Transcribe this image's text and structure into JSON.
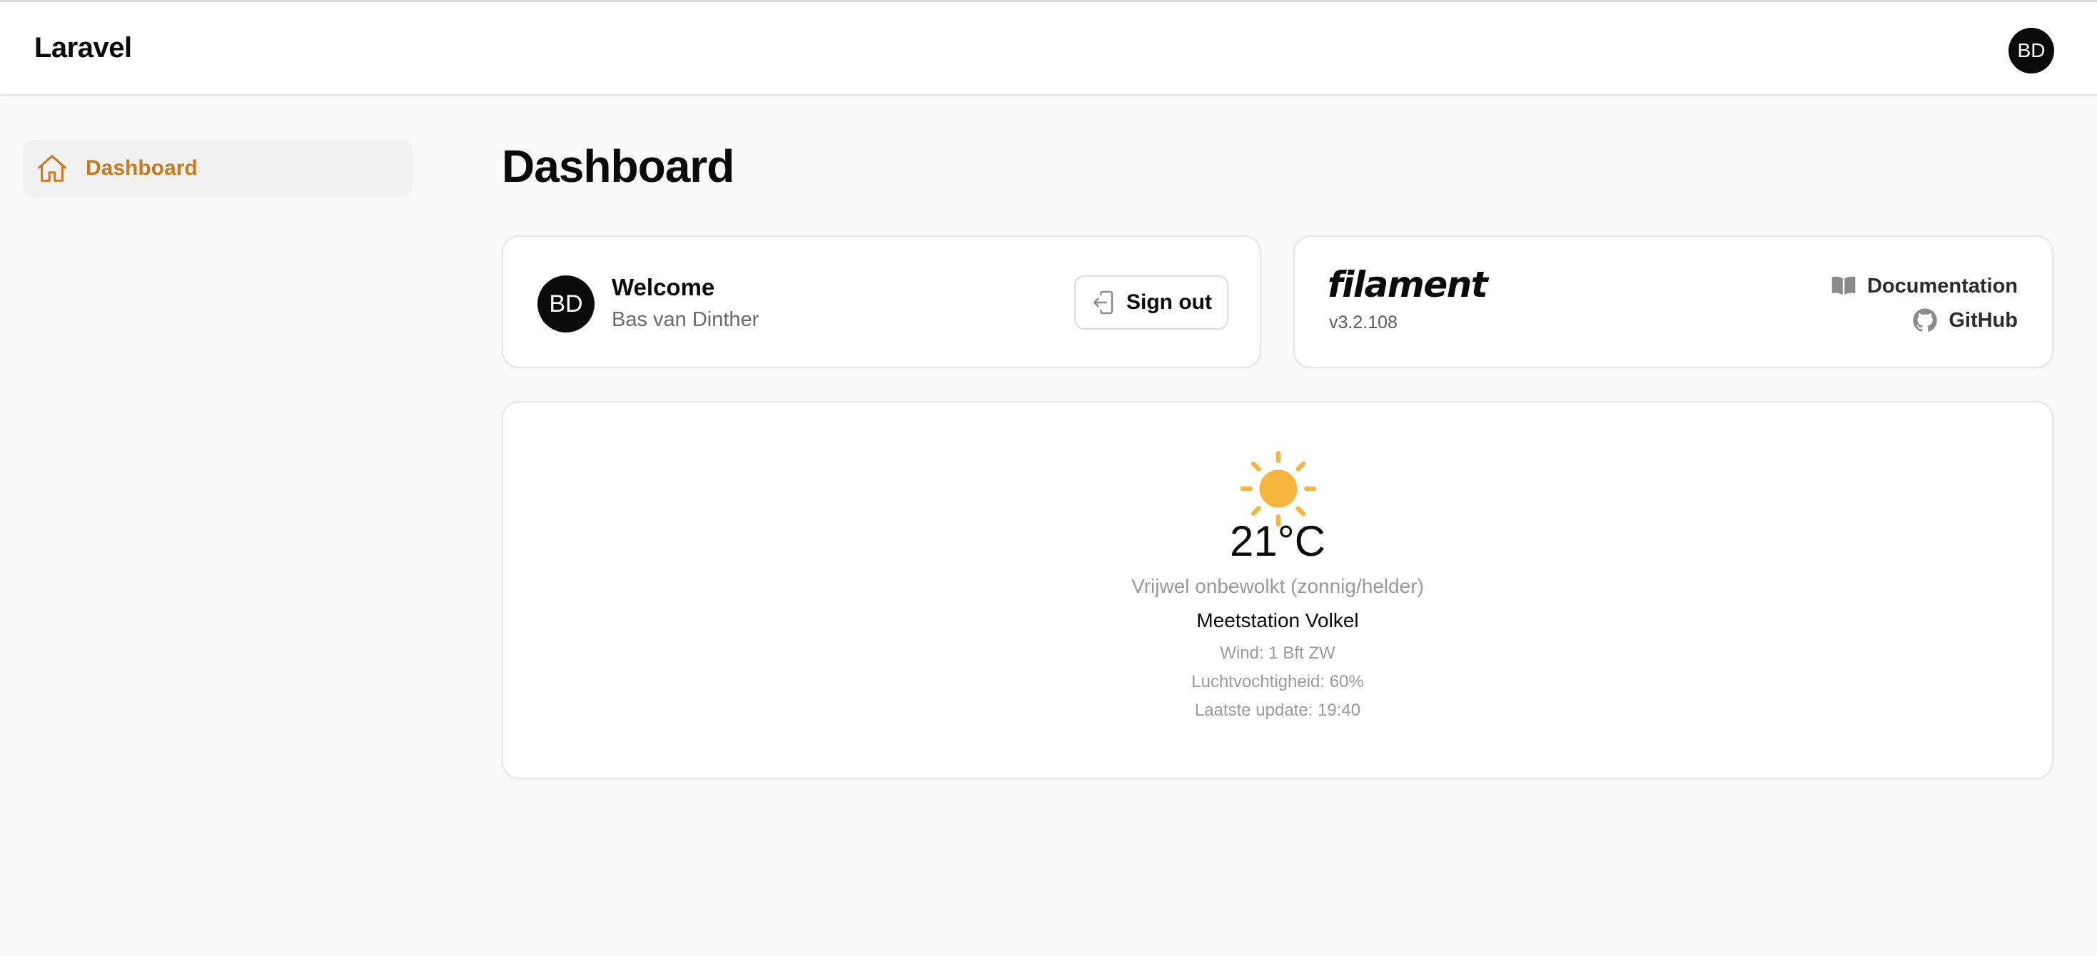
{
  "header": {
    "brand": "Laravel",
    "user_initials": "BD"
  },
  "sidebar": {
    "items": [
      {
        "label": "Dashboard",
        "icon": "home-icon",
        "active": true
      }
    ]
  },
  "main": {
    "title": "Dashboard",
    "welcome_card": {
      "avatar_initials": "BD",
      "title": "Welcome",
      "user_name": "Bas van Dinther",
      "signout_label": "Sign out"
    },
    "filament_card": {
      "logo_text": "filament",
      "version": "v3.2.108",
      "documentation_label": "Documentation",
      "github_label": "GitHub"
    },
    "weather_card": {
      "icon": "sun-icon",
      "temperature": "21°C",
      "condition": "Vrijwel onbewolkt (zonnig/helder)",
      "station": "Meetstation Volkel",
      "wind": "Wind: 1 Bft ZW",
      "humidity": "Luchtvochtigheid: 60%",
      "last_update": "Laatste update: 19:40"
    }
  },
  "colors": {
    "accent": "#c97a1e",
    "sun": "#f5b53f",
    "background": "#f9f9f9",
    "card": "#ffffff"
  }
}
